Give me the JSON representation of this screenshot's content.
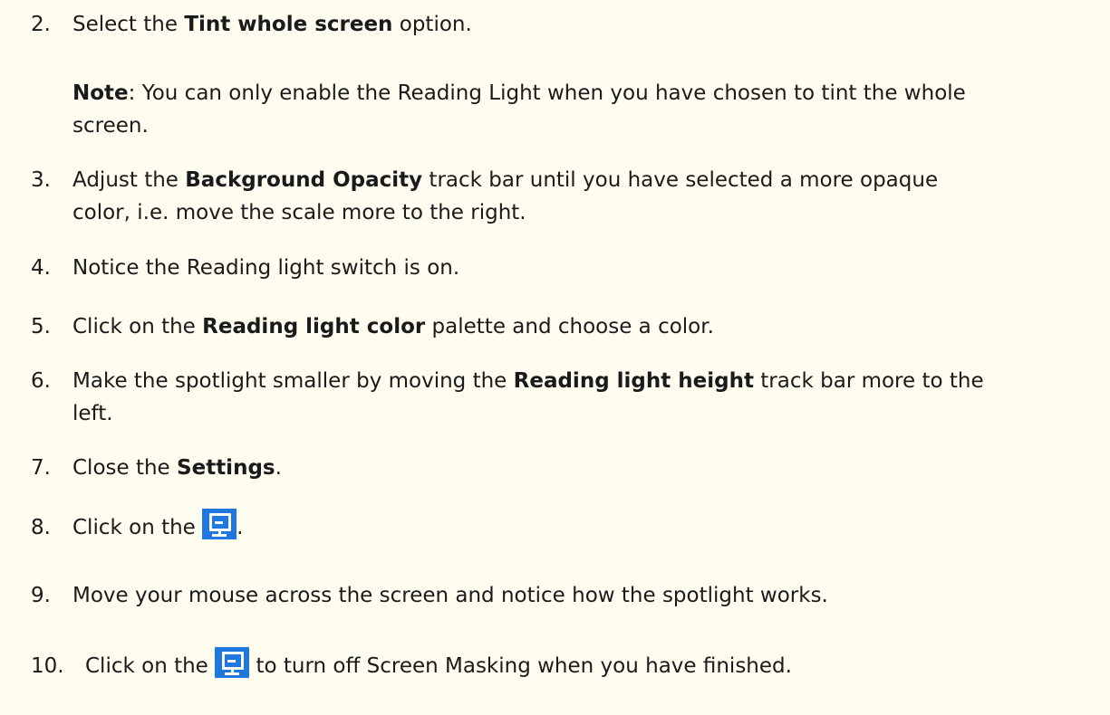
{
  "steps": {
    "s2": {
      "num": "2.",
      "pre": "Select the ",
      "bold": "Tint whole screen",
      "post": " option."
    },
    "note": {
      "label": "Note",
      "text": ":  You can only enable the Reading Light when you have chosen to tint the whole",
      "cont": "screen."
    },
    "s3": {
      "num": "3.",
      "pre": "Adjust the ",
      "bold": "Background Opacity",
      "post": " track bar until you have selected a more opaque",
      "cont": "color, i.e. move the scale more to the right."
    },
    "s4": {
      "num": "4.",
      "text": "Notice the Reading light switch is on."
    },
    "s5": {
      "num": "5.",
      "pre": "Click on the ",
      "bold": "Reading light color",
      "post": " palette and choose a color."
    },
    "s6": {
      "num": "6.",
      "pre": "Make the spotlight smaller by moving the ",
      "bold": "Reading light height",
      "post": " track bar more to the",
      "cont": "left."
    },
    "s7": {
      "num": "7.",
      "pre": "Close the ",
      "bold": "Settings",
      "post": "."
    },
    "s8": {
      "num": "8.",
      "pre": "Click on the ",
      "post": "."
    },
    "s9": {
      "num": "9.",
      "text": "Move your mouse across the screen and notice how the spotlight works."
    },
    "s10": {
      "num": "10.",
      "pre": "Click on the ",
      "post": " to turn off Screen Masking when you have finished."
    }
  },
  "icons": {
    "screen_masking": {
      "name": "screen-masking-icon",
      "color": "#1f77e0"
    }
  }
}
